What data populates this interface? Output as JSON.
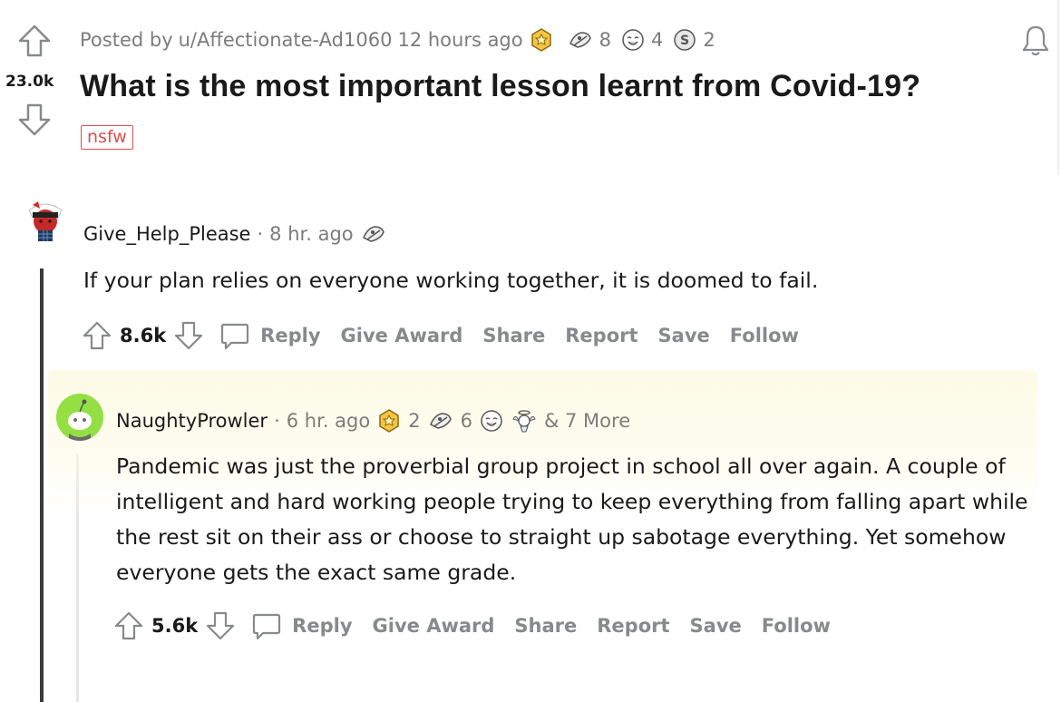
{
  "post": {
    "meta_prefix": "Posted by",
    "author": "u/Affectionate-Ad1060",
    "time": "12 hours ago",
    "award_counts": [
      "8",
      "4",
      "2"
    ],
    "score": "23.0k",
    "title": "What is the most important lesson learnt from Covid-19?",
    "flair": "nsfw"
  },
  "comments": [
    {
      "author": "Give_Help_Please",
      "sep": "·",
      "time": "8 hr. ago",
      "body": "If your plan relies on everyone working together, it is doomed to fail.",
      "score": "8.6k"
    },
    {
      "author": "NaughtyProwler",
      "sep": "·",
      "time": "6 hr. ago",
      "award_counts": [
        "2",
        "6"
      ],
      "more": "& 7 More",
      "body": "Pandemic was just the proverbial group project in school all over again. A couple of intelligent and hard working people trying to keep everything from falling apart while the rest sit on their ass or choose to straight up sabotage everything. Yet somehow everyone gets the exact same grade.",
      "score": "5.6k"
    }
  ],
  "actions": {
    "reply": "Reply",
    "give_award": "Give Award",
    "share": "Share",
    "report": "Report",
    "save": "Save",
    "follow": "Follow"
  },
  "icons": {
    "upvote": "upvote-arrow-icon",
    "downvote": "downvote-arrow-icon",
    "reply": "speech-bubble-icon",
    "bell": "bell-icon"
  },
  "colors": {
    "nsfw": "#e14d4d",
    "muted": "#878a8c",
    "thread_line": "#3a3a3a",
    "avatar2_bg": "#94e044"
  }
}
